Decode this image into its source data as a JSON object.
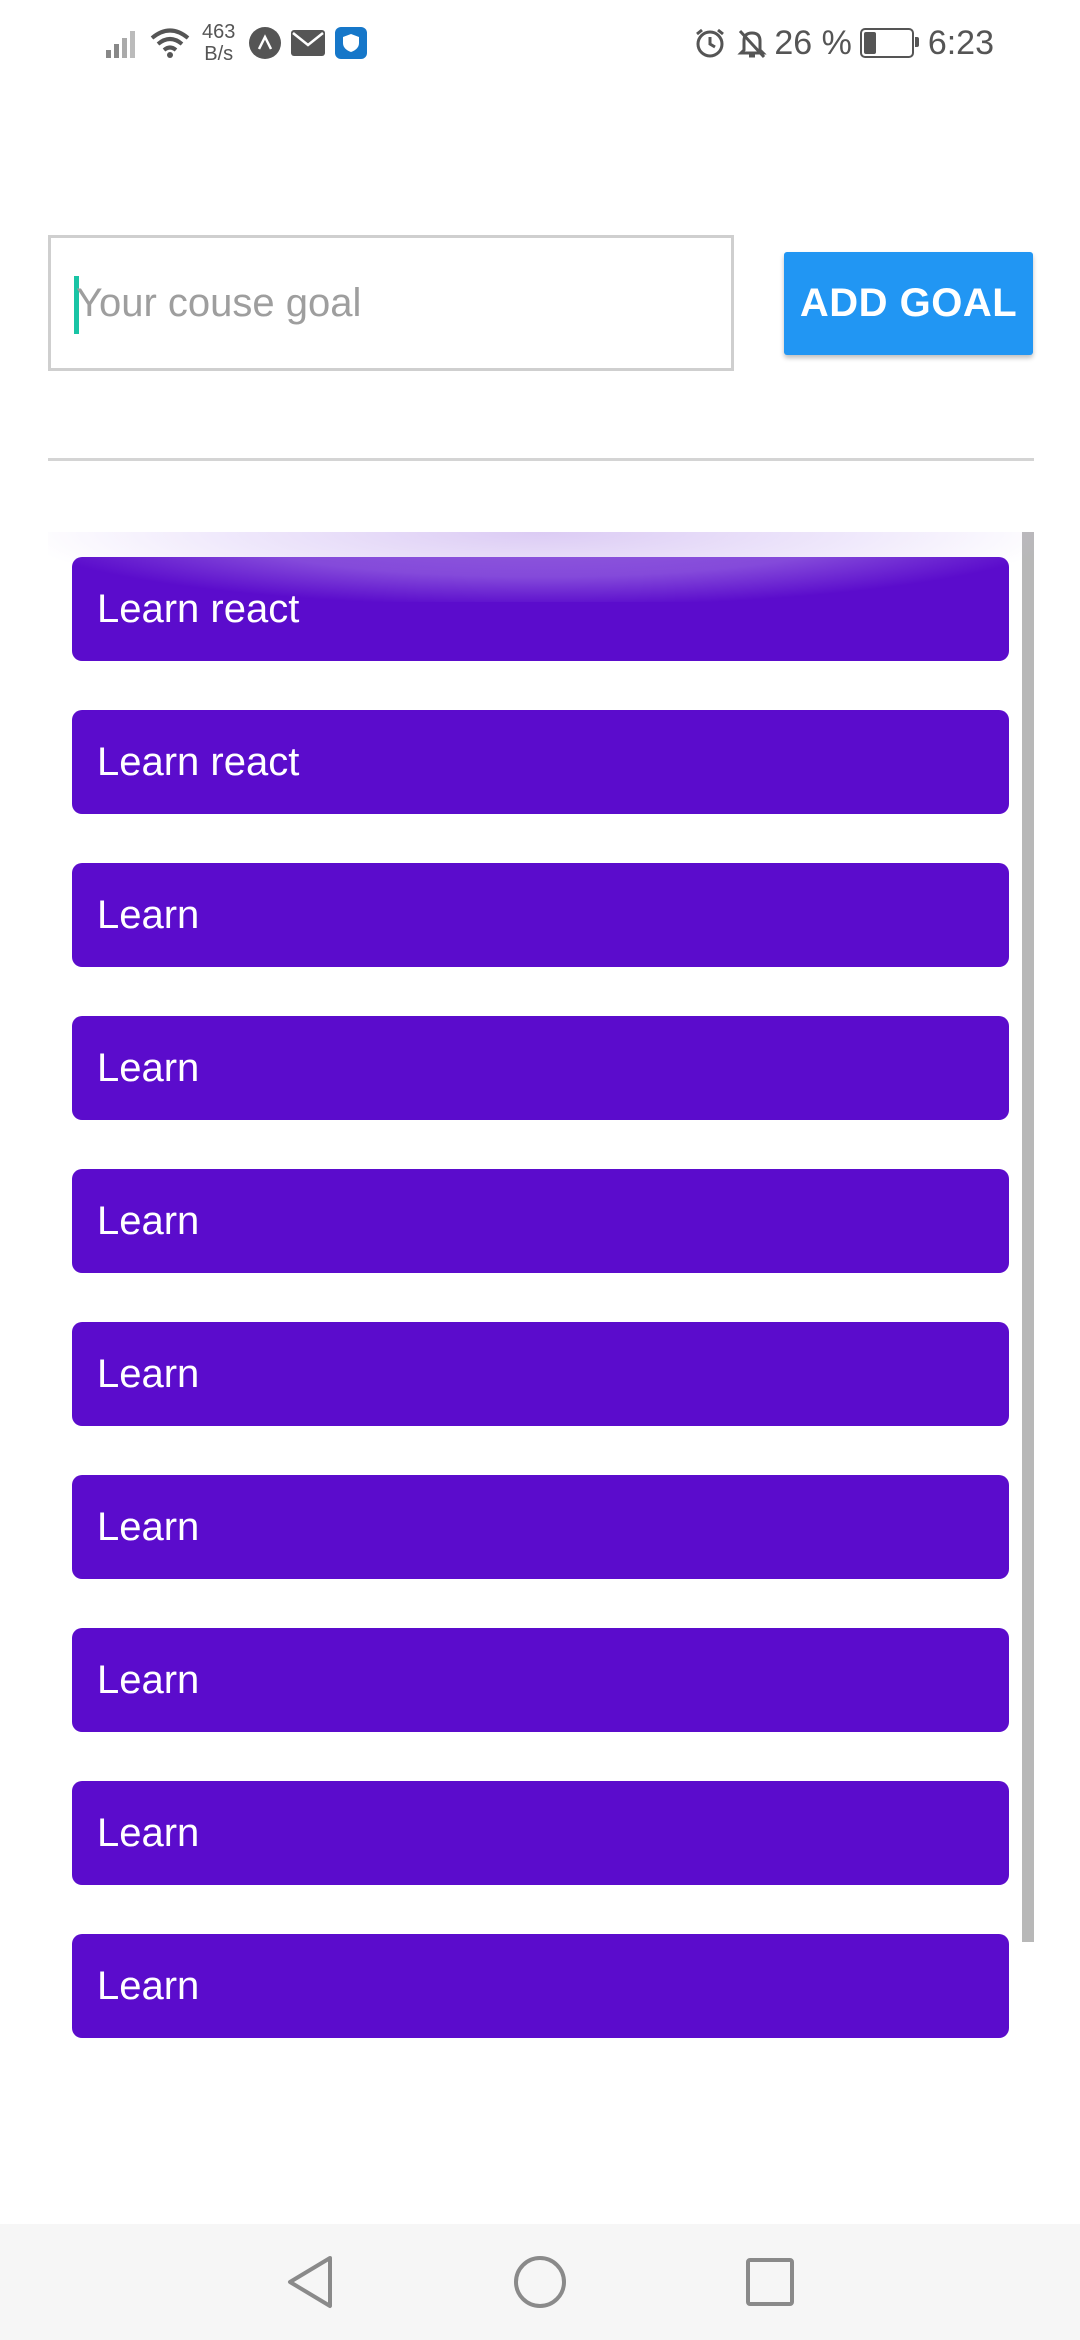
{
  "status_bar": {
    "net_speed_value": "463",
    "net_speed_unit": "B/s",
    "battery_percent": "26 %",
    "battery_level": 0.26,
    "time": "6:23",
    "icons": [
      "signal-icon",
      "wifi-icon",
      "app-notification-icon",
      "mail-icon",
      "shield-icon",
      "alarm-icon",
      "bell-off-icon",
      "battery-icon"
    ]
  },
  "goal_input": {
    "placeholder": "Your couse goal",
    "value": ""
  },
  "add_button": {
    "label": "ADD GOAL"
  },
  "goals": [
    "Learn react",
    "Learn react",
    "Learn",
    "Learn",
    "Learn",
    "Learn",
    "Learn",
    "Learn",
    "Learn",
    "Learn"
  ],
  "colors": {
    "accent": "#2196f3",
    "goal_item": "#5b0ccc",
    "cursor": "#19c4a5"
  },
  "nav_bar": {
    "icons": [
      "back-icon",
      "home-icon",
      "recents-icon"
    ]
  }
}
